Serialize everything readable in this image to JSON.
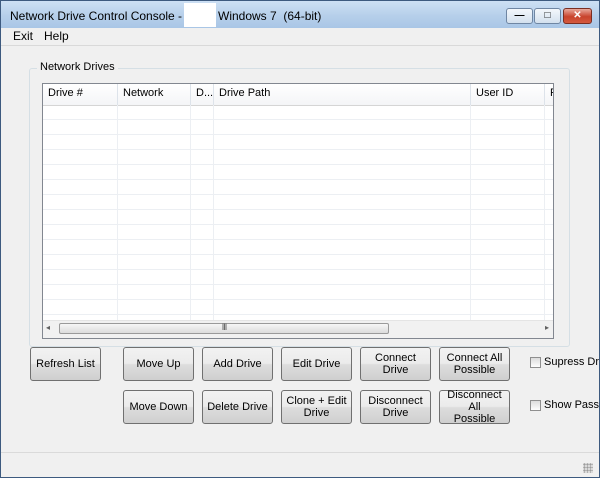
{
  "window": {
    "title_start": "Network Drive Control Console - v",
    "title_end": "Windows 7  (64-bit)"
  },
  "caption_buttons": {
    "minimize": "—",
    "maximize": "□",
    "close": "✕"
  },
  "menu": {
    "items": [
      "Exit",
      "Help"
    ]
  },
  "drives_group": {
    "label": "Network Drives",
    "columns": [
      "Drive #",
      "Network",
      "D...",
      "Drive Path",
      "User ID",
      "P"
    ],
    "rows": []
  },
  "scrollbar": {
    "left_arrow": "◂",
    "right_arrow": "▸",
    "grip": "III"
  },
  "buttons": {
    "refresh_list": "Refresh List",
    "move_up": "Move Up",
    "add_drive": "Add Drive",
    "edit_drive": "Edit Drive",
    "connect_drive": "Connect Drive",
    "connect_all_line1": "Connect All",
    "connect_all_line2": "Possible",
    "move_down": "Move Down",
    "delete_drive": "Delete Drive",
    "clone_edit_line1": "Clone + Edit",
    "clone_edit_line2": "Drive",
    "disconnect_line1": "Disconnect",
    "disconnect_line2": "Drive",
    "disconnect_all_line1": "Disconnect All",
    "disconnect_all_line2": "Possible"
  },
  "checkboxes": {
    "suppress": "Supress Dri",
    "show_password": "Show Passw"
  }
}
